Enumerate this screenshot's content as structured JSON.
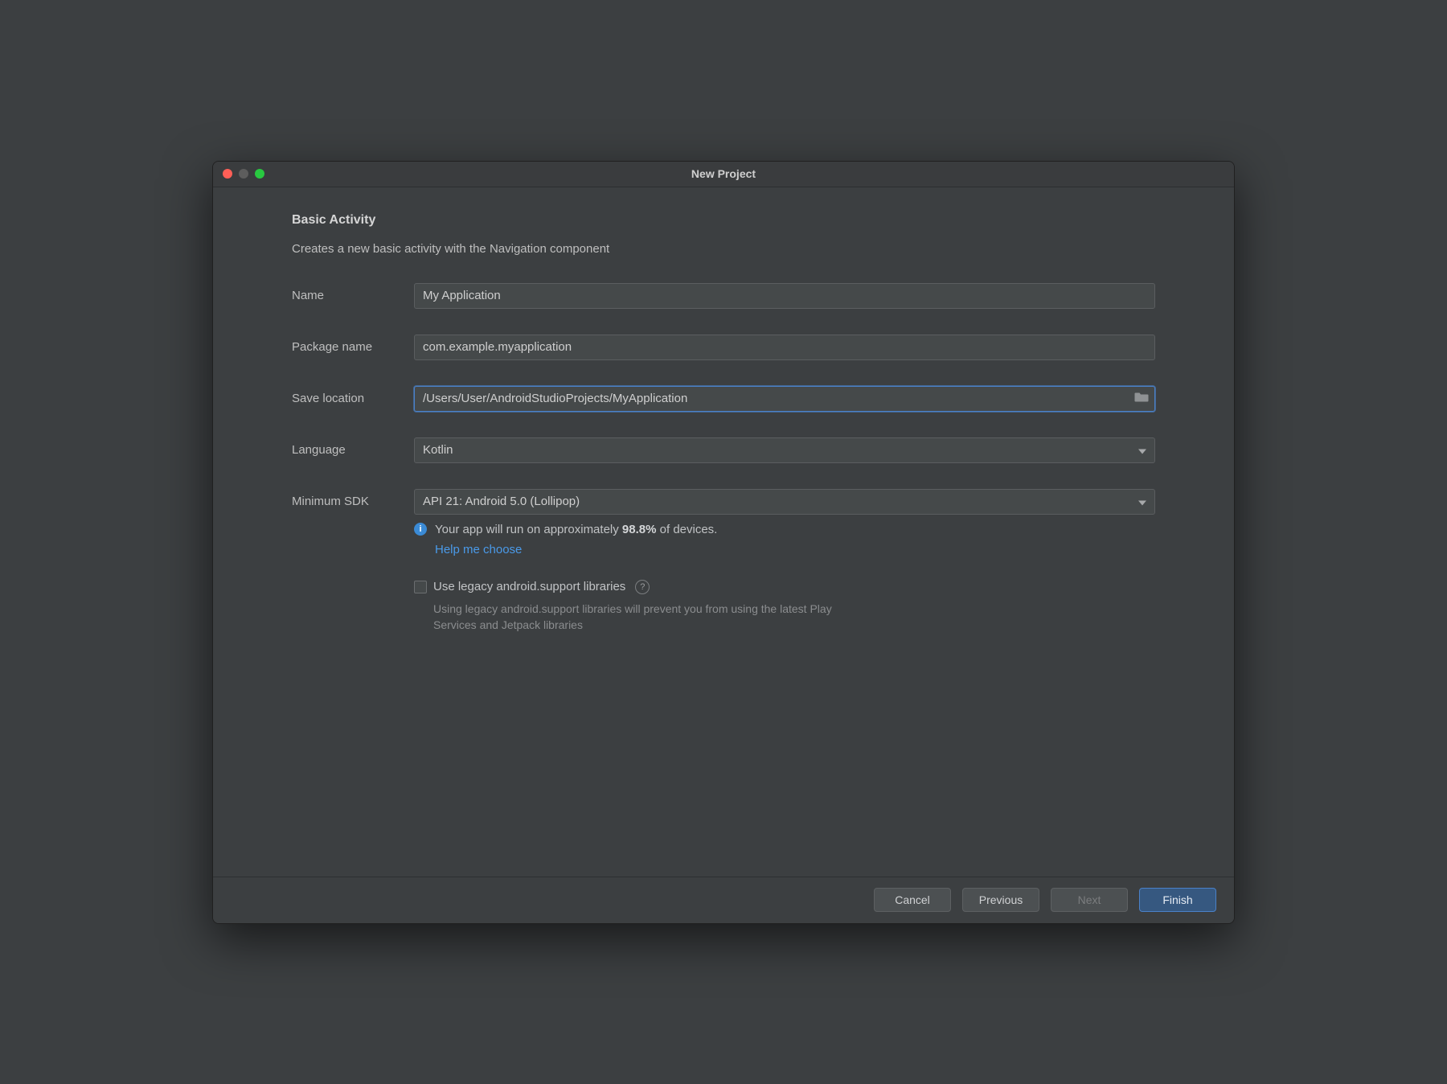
{
  "window": {
    "title": "New Project"
  },
  "page": {
    "heading": "Basic Activity",
    "description": "Creates a new basic activity with the Navigation component"
  },
  "form": {
    "name_label": "Name",
    "name_value": "My Application",
    "package_label": "Package name",
    "package_value": "com.example.myapplication",
    "location_label": "Save location",
    "location_value": "/Users/User/AndroidStudioProjects/MyApplication",
    "language_label": "Language",
    "language_value": "Kotlin",
    "minsdk_label": "Minimum SDK",
    "minsdk_value": "API 21: Android 5.0 (Lollipop)"
  },
  "info": {
    "prefix": "Your app will run on approximately ",
    "pct": "98.8%",
    "suffix": " of devices.",
    "help_link": "Help me choose"
  },
  "legacy": {
    "label": "Use legacy android.support libraries",
    "hint": "Using legacy android.support libraries will prevent you from using the latest Play Services and Jetpack libraries"
  },
  "footer": {
    "cancel": "Cancel",
    "previous": "Previous",
    "next": "Next",
    "finish": "Finish"
  }
}
